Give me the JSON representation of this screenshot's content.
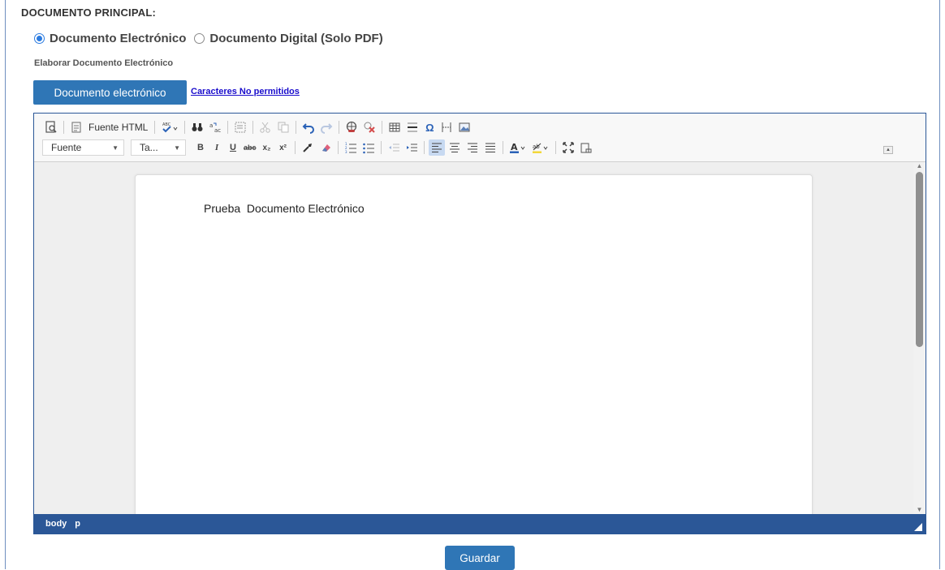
{
  "section": {
    "title": "DOCUMENTO PRINCIPAL:"
  },
  "doc_type": {
    "options": [
      {
        "label": "Documento Electrónico",
        "selected": true
      },
      {
        "label": "Documento Digital (Solo PDF)",
        "selected": false
      }
    ]
  },
  "elaborar": {
    "label": "Elaborar Documento Electrónico"
  },
  "actions": {
    "doc_button": "Documento electrónico",
    "chars_link": "Caracteres No permitidos",
    "save_button": "Guardar"
  },
  "toolbar": {
    "source_label": "Fuente HTML",
    "font_combo": "Fuente",
    "size_combo": "Ta...",
    "bold": "B",
    "italic": "I",
    "underline": "U",
    "strike": "abc",
    "subscript": "x₂",
    "superscript": "x²"
  },
  "editor": {
    "content_text": "Prueba  Documento Electrónico",
    "path": [
      "body",
      "p"
    ]
  },
  "colors": {
    "accent": "#2f76b6",
    "editor_border": "#2b5797",
    "link": "#1a0dcc"
  }
}
